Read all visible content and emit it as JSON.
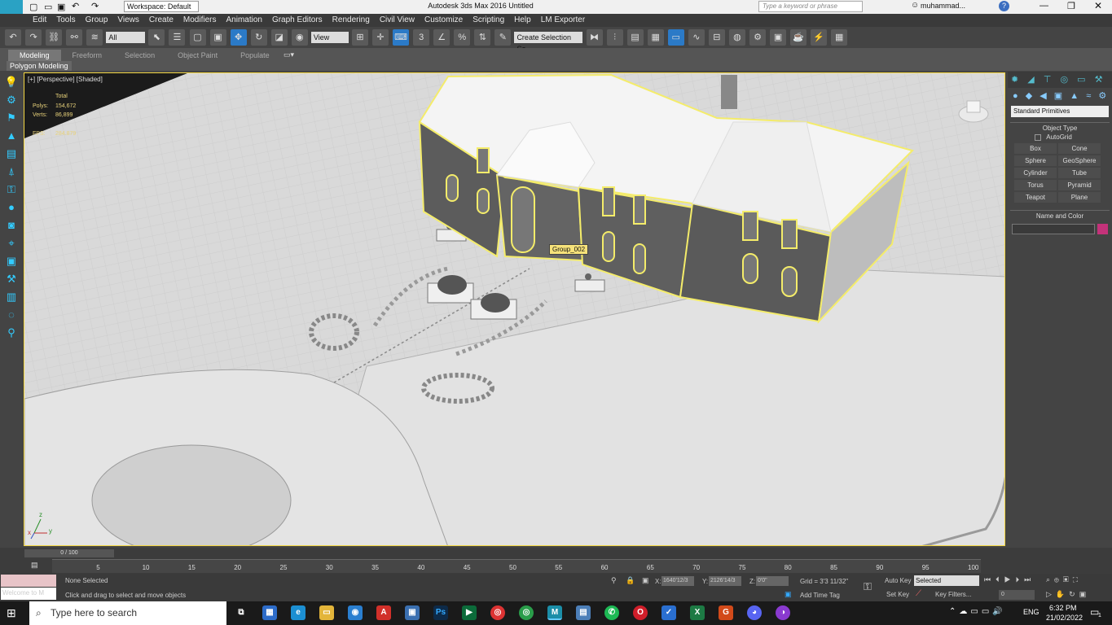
{
  "window": {
    "title": "Autodesk 3ds Max 2016    Untitled",
    "workspace": "Workspace: Default",
    "search_placeholder": "Type a keyword or phrase",
    "user": "muhammad..."
  },
  "menu": [
    "Edit",
    "Tools",
    "Group",
    "Views",
    "Create",
    "Modifiers",
    "Animation",
    "Graph Editors",
    "Rendering",
    "Civil View",
    "Customize",
    "Scripting",
    "Help",
    "LM Exporter"
  ],
  "toolbar": {
    "filter": "All",
    "ref_coord": "View",
    "selection_set": "Create Selection Se"
  },
  "ribbon": {
    "tabs": [
      "Modeling",
      "Freeform",
      "Selection",
      "Object Paint",
      "Populate"
    ],
    "sub_label": "Polygon Modeling"
  },
  "viewport": {
    "label": "[+] [Perspective] [Shaded]",
    "stats_header": "Total",
    "polys_label": "Polys:",
    "polys_value": "154,672",
    "verts_label": "Verts:",
    "verts_value": "86,899",
    "fps_label": "FPS:",
    "fps_value": "284.879",
    "tooltip": "Group_002",
    "axis_x": "x",
    "axis_y": "y",
    "axis_z": "z"
  },
  "command_panel": {
    "category": "Standard Primitives",
    "object_type_header": "Object Type",
    "autogrid": "AutoGrid",
    "buttons": [
      "Box",
      "Cone",
      "Sphere",
      "GeoSphere",
      "Cylinder",
      "Tube",
      "Torus",
      "Pyramid",
      "Teapot",
      "Plane"
    ],
    "name_color_header": "Name and Color",
    "color": "#c4327a"
  },
  "timeline": {
    "frame": "0 / 100",
    "ticks": [
      "0",
      "5",
      "10",
      "15",
      "20",
      "25",
      "30",
      "35",
      "40",
      "45",
      "50",
      "55",
      "60",
      "65",
      "70",
      "75",
      "80",
      "85",
      "90",
      "95",
      "100"
    ]
  },
  "status": {
    "maxscript": "Welcome to M",
    "selection": "None Selected",
    "prompt": "Click and drag to select and move objects",
    "x_label": "X:",
    "x_value": "1640'12/3",
    "y_label": "Y:",
    "y_value": "2126'14/3",
    "z_label": "Z:",
    "z_value": "0'0\"",
    "grid": "Grid = 3'3 11/32\"",
    "add_time_tag": "Add Time Tag",
    "auto_key": "Auto Key",
    "auto_key_mode": "Selected",
    "set_key": "Set Key",
    "key_filters": "Key Filters...",
    "current_frame": "0"
  },
  "taskbar": {
    "search_placeholder": "Type here to search",
    "lang": "ENG",
    "time": "6:32 PM",
    "date": "21/02/2022",
    "notification_count": "1"
  }
}
